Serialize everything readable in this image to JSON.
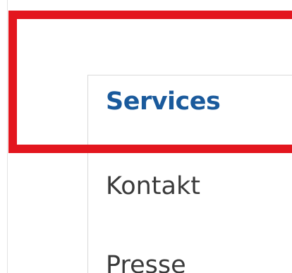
{
  "menu": {
    "items": [
      {
        "label": "Services",
        "active": true
      },
      {
        "label": "Kontakt",
        "active": false
      },
      {
        "label": "Presse",
        "active": false
      }
    ]
  },
  "colors": {
    "active_text": "#1a5a9c",
    "text": "#3a3a3a",
    "highlight": "#e3161e"
  }
}
